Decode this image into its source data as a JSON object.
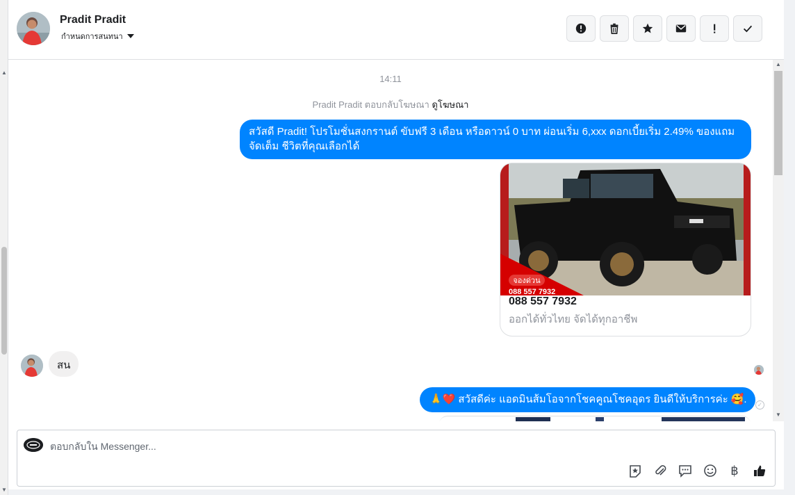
{
  "header": {
    "contact_name": "Pradit Pradit",
    "assign_label": "กำหนดการสนทนา",
    "toolbar": [
      {
        "name": "report-spam-button",
        "icon": "alert-circle-icon"
      },
      {
        "name": "delete-button",
        "icon": "trash-icon"
      },
      {
        "name": "star-button",
        "icon": "star-icon"
      },
      {
        "name": "mark-unread-button",
        "icon": "envelope-icon"
      },
      {
        "name": "follow-up-button",
        "icon": "exclamation-icon"
      },
      {
        "name": "mark-done-button",
        "icon": "check-icon"
      }
    ]
  },
  "chat": {
    "timestamp": "14:11",
    "ad_reply_prefix": "Pradit Pradit ตอบกลับโฆษณา",
    "ad_reply_link": "ดูโฆษณา",
    "messages": [
      {
        "direction": "outgoing",
        "text": "สวัสดี Pradit! โปรโมชั่นสงกรานต์ ขับฟรี 3 เดือน หรือดาวน์ 0 บาท ผ่อนเริ่ม 6,xxx ดอกเบี้ยเริ่ม 2.49% ของแถมจัดเต็ม ชีวิตที่คุณเลือกได้"
      },
      {
        "direction": "outgoing",
        "type": "card",
        "image_alt": "Black ISUZU pickup truck",
        "badge_text": "จองด่วน",
        "image_phone_text": "088 557 7932",
        "title": "088 557 7932",
        "description": "ออกได้ทั่วไทย จัดได้ทุกอาชีพ"
      },
      {
        "direction": "incoming",
        "text": "สน"
      },
      {
        "direction": "outgoing",
        "prefix_emoji": "🙏❤️",
        "text": "สวัสดีค่ะ แอดมินส้มโอจากโชคคูณโชคอุดร ยินดีให้บริการค่ะ",
        "suffix_emoji": "🥰."
      }
    ]
  },
  "composer": {
    "placeholder": "ตอบกลับใน Messenger...",
    "tools": [
      "sticker-icon",
      "paperclip-icon",
      "saved-reply-icon",
      "emoji-icon",
      "baht-icon",
      "thumbs-up-icon"
    ],
    "baht_symbol": "฿"
  },
  "colors": {
    "accent": "#0084ff",
    "incoming_bubble": "#f1f0f0",
    "muted_text": "#90949c"
  }
}
